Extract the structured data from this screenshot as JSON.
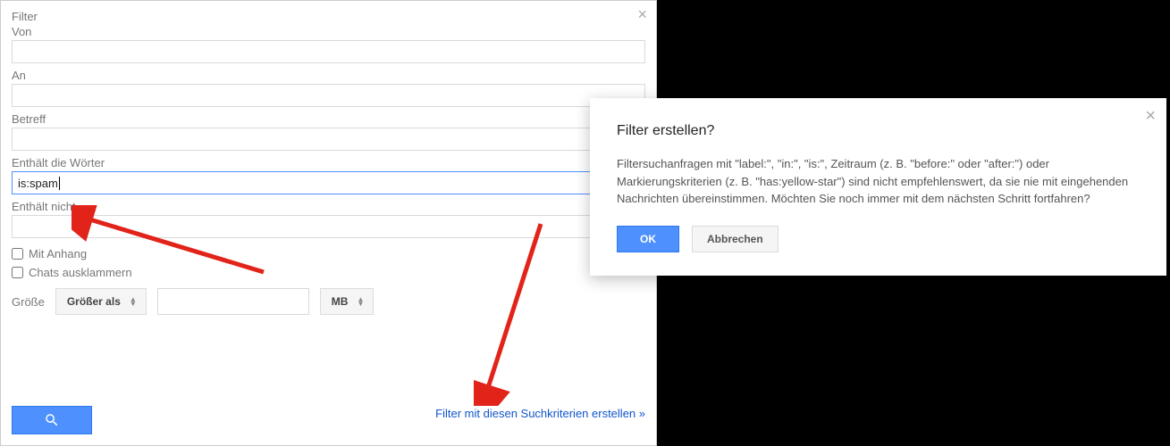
{
  "filter_panel": {
    "title": "Filter",
    "from_label": "Von",
    "to_label": "An",
    "subject_label": "Betreff",
    "has_words_label": "Enthält die Wörter",
    "has_words_value": "is:spam",
    "not_has_label": "Enthält nicht",
    "attach_label": "Mit Anhang",
    "exclude_chats_label": "Chats ausklammern",
    "size_label": "Größe",
    "size_op": "Größer als",
    "size_unit": "MB",
    "create_link": "Filter mit diesen Suchkriterien erstellen »"
  },
  "dialog": {
    "title": "Filter erstellen?",
    "body": "Filtersuchanfragen mit \"label:\", \"in:\", \"is:\", Zeitraum (z. B. \"before:\" oder \"after:\") oder Markierungskriterien (z. B. \"has:yellow-star\") sind nicht empfehlenswert, da sie nie mit eingehenden Nachrichten übereinstimmen. Möchten Sie noch immer mit dem nächsten Schritt fortfahren?",
    "ok": "OK",
    "cancel": "Abbrechen"
  },
  "colors": {
    "accent": "#4d90fe",
    "link": "#1155cc"
  }
}
